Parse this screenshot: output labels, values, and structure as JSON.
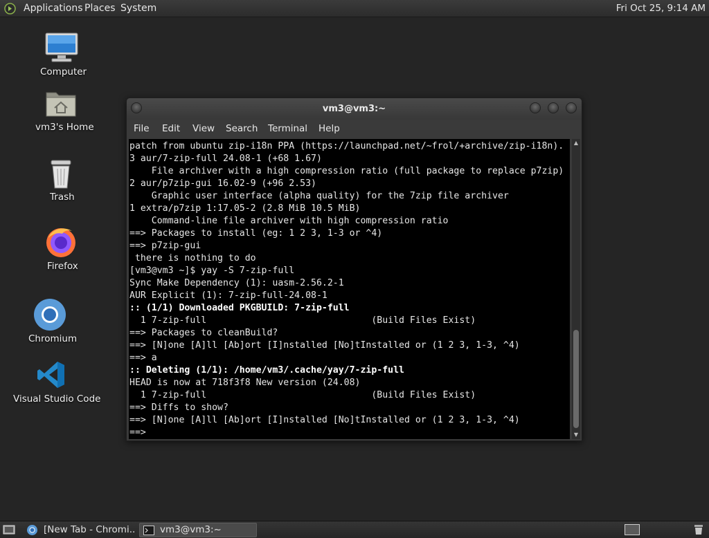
{
  "top_panel": {
    "menus": [
      "Applications",
      "Places",
      "System"
    ],
    "clock": "Fri Oct 25,  9:14 AM"
  },
  "desktop_icons": [
    {
      "label": "Computer",
      "icon": "computer-icon"
    },
    {
      "label": "vm3's Home",
      "icon": "home-folder-icon"
    },
    {
      "label": "Trash",
      "icon": "trash-icon"
    },
    {
      "label": "Firefox",
      "icon": "firefox-icon"
    },
    {
      "label": "Chromium",
      "icon": "chromium-icon"
    },
    {
      "label": "Visual Studio Code",
      "icon": "vscode-icon"
    }
  ],
  "terminal": {
    "title": "vm3@vm3:~",
    "menu": [
      "File",
      "Edit",
      "View",
      "Search",
      "Terminal",
      "Help"
    ],
    "lines": [
      {
        "text": "patch from ubuntu zip-i18n PPA (https://launchpad.net/~frol/+archive/zip-i18n).",
        "bold": false
      },
      {
        "text": "3 aur/7-zip-full 24.08-1 (+68 1.67)",
        "bold": false
      },
      {
        "text": "    File archiver with a high compression ratio (full package to replace p7zip)",
        "bold": false
      },
      {
        "text": "2 aur/p7zip-gui 16.02-9 (+96 2.53)",
        "bold": false
      },
      {
        "text": "    Graphic user interface (alpha quality) for the 7zip file archiver",
        "bold": false
      },
      {
        "text": "1 extra/p7zip 1:17.05-2 (2.8 MiB 10.5 MiB)",
        "bold": false
      },
      {
        "text": "    Command-line file archiver with high compression ratio",
        "bold": false
      },
      {
        "text": "==> Packages to install (eg: 1 2 3, 1-3 or ^4)",
        "bold": false
      },
      {
        "text": "==> p7zip-gui",
        "bold": false
      },
      {
        "text": " there is nothing to do",
        "bold": false
      },
      {
        "text": "[vm3@vm3 ~]$ yay -S 7-zip-full",
        "bold": false
      },
      {
        "text": "Sync Make Dependency (1): uasm-2.56.2-1",
        "bold": false
      },
      {
        "text": "AUR Explicit (1): 7-zip-full-24.08-1",
        "bold": false
      },
      {
        "text": ":: (1/1) Downloaded PKGBUILD: 7-zip-full",
        "bold": true
      },
      {
        "text": "  1 7-zip-full                              (Build Files Exist)",
        "bold": false
      },
      {
        "text": "==> Packages to cleanBuild?",
        "bold": false
      },
      {
        "text": "==> [N]one [A]ll [Ab]ort [I]nstalled [No]tInstalled or (1 2 3, 1-3, ^4)",
        "bold": false
      },
      {
        "text": "==> a",
        "bold": false
      },
      {
        "text": ":: Deleting (1/1): /home/vm3/.cache/yay/7-zip-full",
        "bold": true
      },
      {
        "text": "HEAD is now at 718f3f8 New version (24.08)",
        "bold": false
      },
      {
        "text": "  1 7-zip-full                              (Build Files Exist)",
        "bold": false
      },
      {
        "text": "==> Diffs to show?",
        "bold": false
      },
      {
        "text": "==> [N]one [A]ll [Ab]ort [I]nstalled [No]tInstalled or (1 2 3, 1-3, ^4)",
        "bold": false
      },
      {
        "text": "==> ",
        "bold": false
      }
    ]
  },
  "taskbar": {
    "tasks": [
      {
        "label": "[New Tab - Chromi...",
        "icon": "chromium-icon",
        "active": false
      },
      {
        "label": "vm3@vm3:~",
        "icon": "terminal-icon",
        "active": true
      }
    ]
  }
}
